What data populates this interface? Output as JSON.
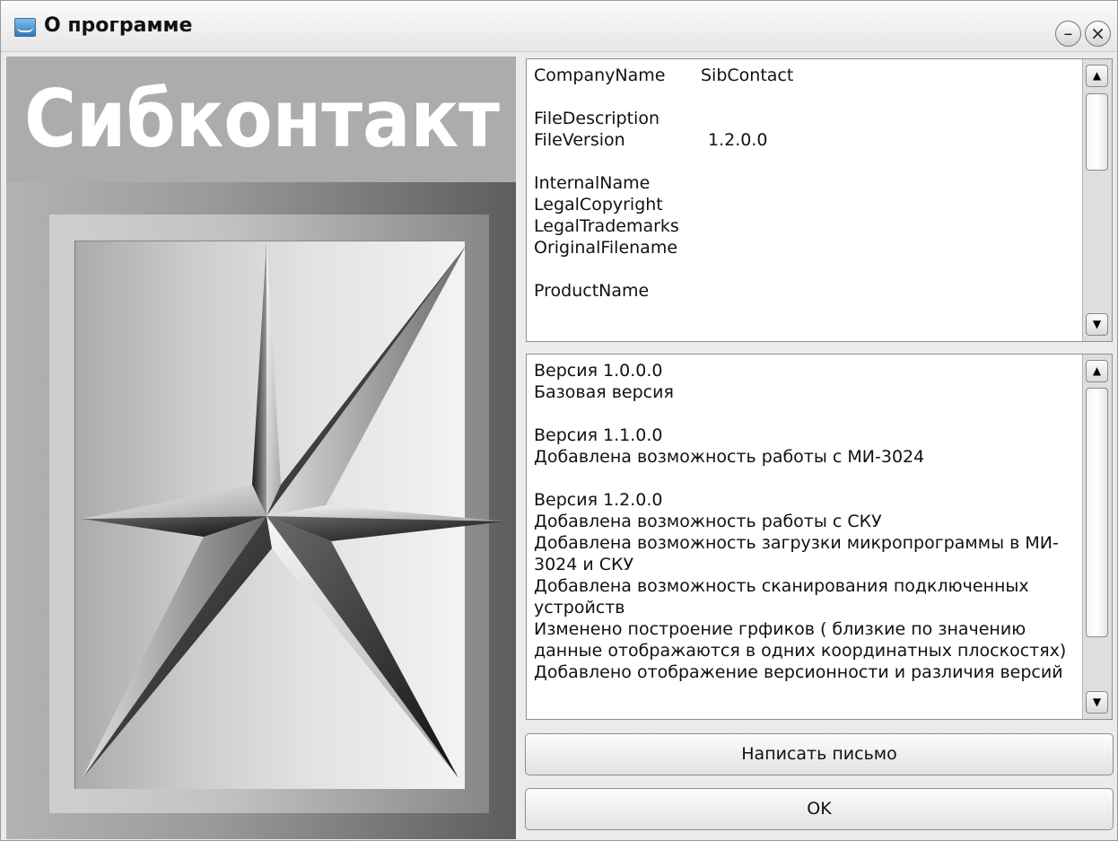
{
  "window": {
    "title": "О программе"
  },
  "logo": {
    "text": "Сибконтакт"
  },
  "info": [
    {
      "key": "CompanyName",
      "value": "SibContact"
    },
    {
      "key": "",
      "value": ""
    },
    {
      "key": "FileDescription",
      "value": ""
    },
    {
      "key": "FileVersion",
      "value": "1.2.0.0"
    },
    {
      "key": "",
      "value": ""
    },
    {
      "key": "InternalName",
      "value": ""
    },
    {
      "key": "LegalCopyright",
      "value": ""
    },
    {
      "key": "LegalTrademarks",
      "value": ""
    },
    {
      "key": "OriginalFilename",
      "value": ""
    },
    {
      "key": "",
      "value": ""
    },
    {
      "key": "ProductName",
      "value": ""
    }
  ],
  "history": [
    "Версия 1.0.0.0",
    "Базовая версия",
    "",
    "Версия 1.1.0.0",
    "Добавлена возможность работы с МИ-3024",
    "",
    "Версия 1.2.0.0",
    "Добавлена возможность работы с СКУ",
    "Добавлена возможность загрузки микропрограммы в МИ-",
    "3024 и СКУ",
    "Добавлена возможность сканирования подключенных",
    "устройств",
    "Изменено построение грфиков ( близкие по значению",
    "данные отображаются в одних координатных плоскостях)",
    "Добавлено отображение версионности и различия версий"
  ],
  "buttons": {
    "write_letter": "Написать письмо",
    "ok": "OK"
  },
  "controls": {
    "minimize": "–",
    "close": "×",
    "scroll_up": "▲",
    "scroll_down": "▼"
  }
}
